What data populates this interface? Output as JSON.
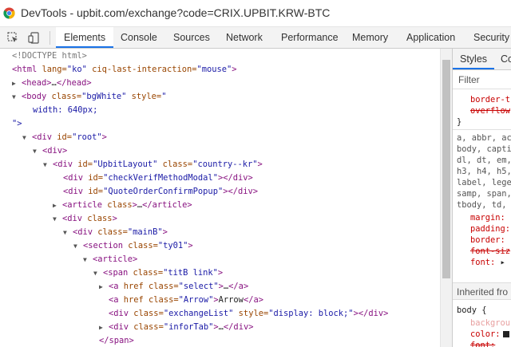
{
  "window": {
    "title": "DevTools - upbit.com/exchange?code=CRIX.UPBIT.KRW-BTC"
  },
  "toolbar": {
    "inspect_icon": "inspect-element-icon",
    "device_icon": "device-toolbar-icon",
    "tabs": [
      {
        "label": "Elements",
        "active": true
      },
      {
        "label": "Console",
        "active": false
      },
      {
        "label": "Sources",
        "active": false
      },
      {
        "label": "Network",
        "active": false
      },
      {
        "label": "Performance",
        "active": false
      },
      {
        "label": "Memory",
        "active": false
      },
      {
        "label": "Application",
        "active": false
      },
      {
        "label": "Security",
        "active": false
      }
    ]
  },
  "dom": {
    "l0": "<!DOCTYPE html>",
    "l1": {
      "tag": "<html",
      "a1": " lang=",
      "v1": "\"ko\"",
      "a2": " ciq-last-interaction=",
      "v2": "\"mouse\"",
      "end": ">"
    },
    "l2": {
      "tag": "<head>",
      "ell": "…",
      "close": "</head>"
    },
    "l3": {
      "tag": "<body",
      "a1": " class=",
      "v1": "\"bgWhite\"",
      "a2": " style=",
      "v2": "\""
    },
    "l4": {
      "v": "width: 640px;"
    },
    "l5": {
      "v": "\">"
    },
    "l6": {
      "tag": "<div",
      "a1": " id=",
      "v1": "\"root\"",
      "end": ">"
    },
    "l7": {
      "tag": "<div>"
    },
    "l8": {
      "tag": "<div",
      "a1": " id=",
      "v1": "\"UpbitLayout\"",
      "a2": " class=",
      "v2": "\"country--kr\"",
      "end": ">"
    },
    "l9": {
      "tag": "<div",
      "a1": " id=",
      "v1": "\"checkVerifMethodModal\"",
      "end": "></div>"
    },
    "l10": {
      "tag": "<div",
      "a1": " id=",
      "v1": "\"QuoteOrderConfirmPopup\"",
      "end": "></div>"
    },
    "l11": {
      "tag": "<article",
      "a1": " class",
      "end": ">",
      "ell": "…",
      "close": "</article>"
    },
    "l12": {
      "tag": "<div",
      "a1": " class",
      "end": ">"
    },
    "l13": {
      "tag": "<div",
      "a1": " class=",
      "v1": "\"mainB\"",
      "end": ">"
    },
    "l14": {
      "tag": "<section",
      "a1": " class=",
      "v1": "\"ty01\"",
      "end": ">"
    },
    "l15": {
      "tag": "<article>"
    },
    "l16": {
      "tag": "<span",
      "a1": " class=",
      "v1": "\"titB link\"",
      "end": ">"
    },
    "l17": {
      "tag": "<a",
      "a1": " href class=",
      "v1": "\"select\"",
      "end": ">",
      "ell": "…",
      "close": "</a>"
    },
    "l18": {
      "tag": "<a",
      "a1": " href class=",
      "v1": "\"Arrow\"",
      "end": ">",
      "text": "Arrow",
      "close": "</a>"
    },
    "l19": {
      "tag": "<div",
      "a1": " class=",
      "v1": "\"exchangeList\"",
      "a2": " style=",
      "v2": "\"display: block;\"",
      "end": "></div>"
    },
    "l20": {
      "tag": "<div",
      "a1": " class=",
      "v1": "\"inforTab\"",
      "end": ">",
      "ell": "…",
      "close": "</div>"
    },
    "l21": {
      "close": "</span>"
    }
  },
  "styles_pane": {
    "tabs": [
      {
        "label": "Styles",
        "active": true
      },
      {
        "label": "Co",
        "active": false
      }
    ],
    "filter_placeholder": "Filter",
    "r1_prop1": "border-t",
    "r1_prop2": "overflow",
    "r1_close": "}",
    "sel1": "a, abbr, ac",
    "sel2": "body, capti",
    "sel3": "dl, dt, em,",
    "sel4": "h3, h4, h5,",
    "sel5": "label, lege",
    "sel6": "samp, span,",
    "sel7": "tbody, td,",
    "p_margin": "margin:",
    "p_padding": "padding:",
    "p_border": "border:",
    "p_fontsize": "font-siz",
    "p_font": "font:",
    "inherited_label": "Inherited fro",
    "body_sel": "body {",
    "b_prop1": "backgrou",
    "b_prop2": "color:",
    "b_prop3": "font:"
  },
  "colors": {
    "tag": "#881280",
    "attr_name": "#994500",
    "attr_value": "#1a1aa6",
    "active_tab_underline": "#1a73e8"
  }
}
